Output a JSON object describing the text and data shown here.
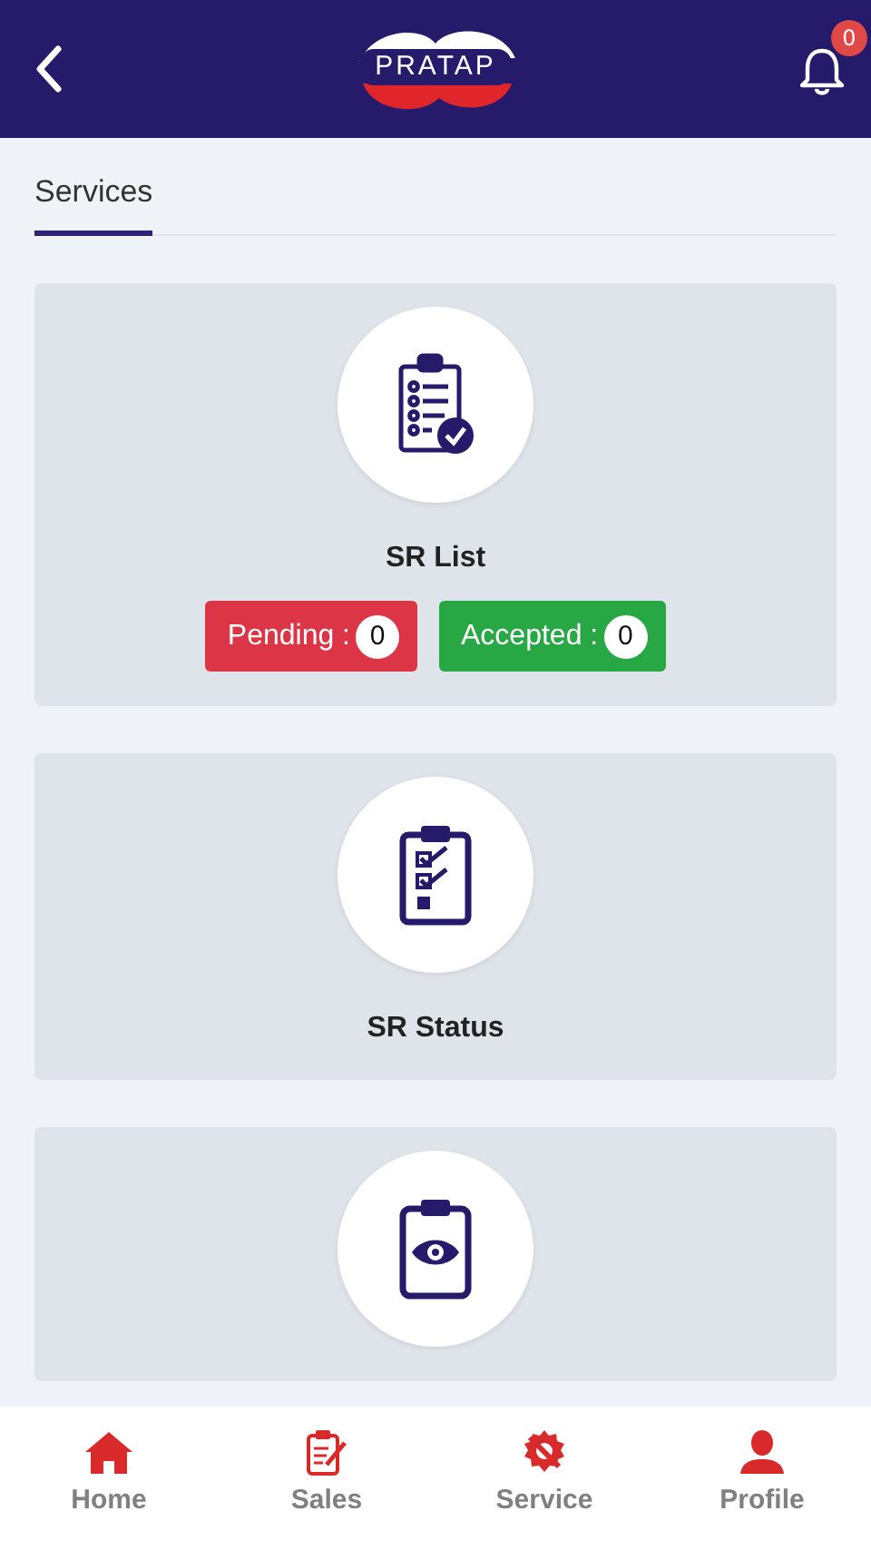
{
  "header": {
    "logo_text": "PRATAP",
    "notification_count": "0"
  },
  "tabs": [
    {
      "label": "Services",
      "selected": true
    }
  ],
  "cards": [
    {
      "kind": "checklist",
      "title": "SR List",
      "badges": [
        {
          "kind": "pending",
          "label": "Pending :",
          "count": "0"
        },
        {
          "kind": "accepted",
          "label": "Accepted :",
          "count": "0"
        }
      ]
    },
    {
      "kind": "status",
      "title": "SR Status"
    },
    {
      "kind": "view"
    }
  ],
  "bottom_nav": [
    {
      "kind": "home",
      "label": "Home"
    },
    {
      "kind": "sales",
      "label": "Sales"
    },
    {
      "kind": "service",
      "label": "Service"
    },
    {
      "kind": "profile",
      "label": "Profile"
    }
  ]
}
